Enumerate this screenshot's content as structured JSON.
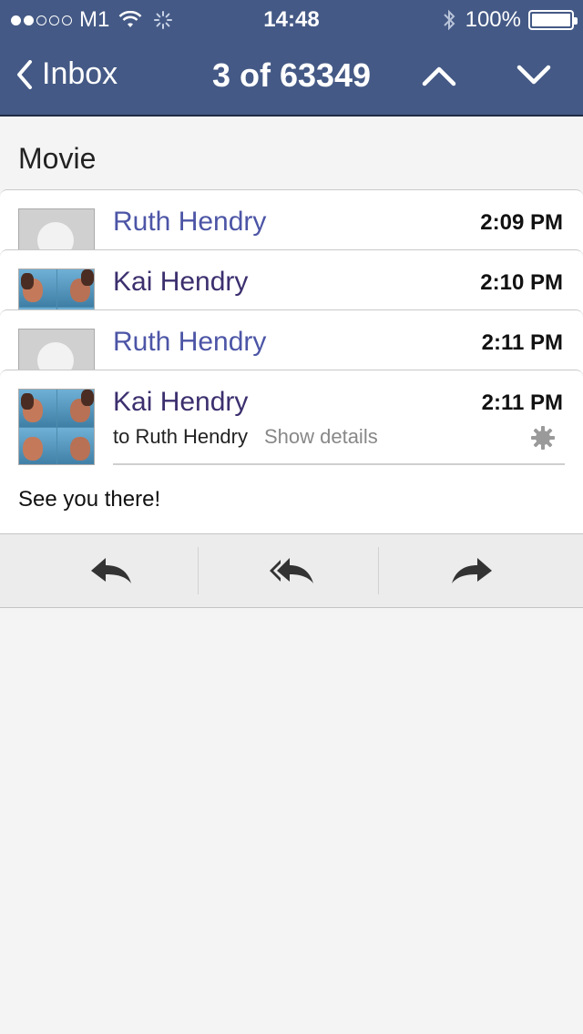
{
  "status_bar": {
    "carrier": "M1",
    "time": "14:48",
    "battery": "100%"
  },
  "nav": {
    "back_label": "Inbox",
    "title": "3 of 63349"
  },
  "subject": "Movie",
  "messages": [
    {
      "sender": "Ruth Hendry",
      "time": "2:09 PM"
    },
    {
      "sender": "Kai Hendry",
      "time": "2:10 PM"
    },
    {
      "sender": "Ruth Hendry",
      "time": "2:11 PM"
    },
    {
      "sender": "Kai Hendry",
      "time": "2:11 PM",
      "to": "to Ruth Hendry",
      "show_details": "Show details",
      "body": "See you there!"
    }
  ],
  "colors": {
    "navbar": "#445985",
    "ruth_name": "#4c55a6",
    "kai_name": "#3c2f6e",
    "background": "#f4f4f4"
  },
  "icons": [
    "wifi-icon",
    "loading-spinner-icon",
    "bluetooth-icon",
    "battery-icon",
    "chevron-left-icon",
    "chevron-up-icon",
    "chevron-down-icon",
    "gear-icon",
    "reply-icon",
    "reply-all-icon",
    "forward-icon"
  ]
}
